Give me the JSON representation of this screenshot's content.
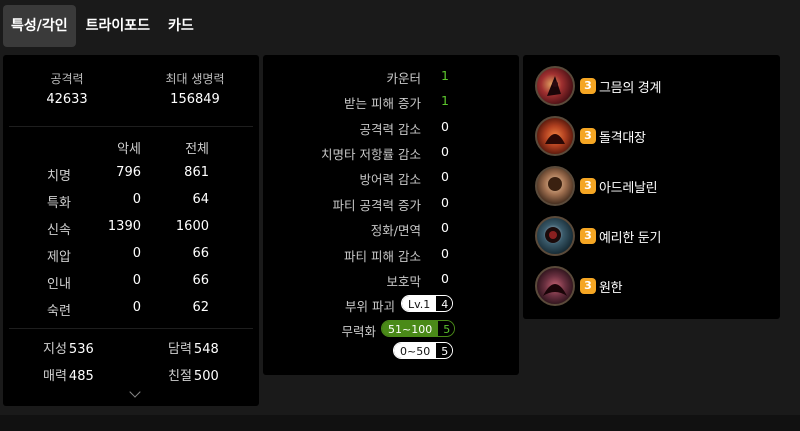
{
  "tabs": [
    {
      "label": "특성/각인",
      "active": true
    },
    {
      "label": "트라이포드",
      "active": false
    },
    {
      "label": "카드",
      "active": false
    }
  ],
  "stats": {
    "attack_label": "공격력",
    "attack_value": "42633",
    "hp_label": "최대 생명력",
    "hp_value": "156849",
    "col_headers": [
      "악세",
      "전체"
    ],
    "rows": [
      {
        "name": "치명",
        "acc": "796",
        "total": "861"
      },
      {
        "name": "특화",
        "acc": "0",
        "total": "64"
      },
      {
        "name": "신속",
        "acc": "1390",
        "total": "1600"
      },
      {
        "name": "제압",
        "acc": "0",
        "total": "66"
      },
      {
        "name": "인내",
        "acc": "0",
        "total": "66"
      },
      {
        "name": "숙련",
        "acc": "0",
        "total": "62"
      }
    ],
    "extras": [
      {
        "name": "지성",
        "value": "536"
      },
      {
        "name": "담력",
        "value": "548"
      },
      {
        "name": "매력",
        "value": "485"
      },
      {
        "name": "친절",
        "value": "500"
      }
    ]
  },
  "modifiers": {
    "rows": [
      {
        "label": "카운터",
        "value": "1",
        "green": true
      },
      {
        "label": "받는 피해 증가",
        "value": "1",
        "green": true
      },
      {
        "label": "공격력 감소",
        "value": "0",
        "green": false
      },
      {
        "label": "치명타 저항률 감소",
        "value": "0",
        "green": false
      },
      {
        "label": "방어력 감소",
        "value": "0",
        "green": false
      },
      {
        "label": "파티 공격력 증가",
        "value": "0",
        "green": false
      },
      {
        "label": "정화/면역",
        "value": "0",
        "green": false
      },
      {
        "label": "파티 피해 감소",
        "value": "0",
        "green": false
      },
      {
        "label": "보호막",
        "value": "0",
        "green": false
      }
    ],
    "part_break": {
      "label": "부위 파괴",
      "level": "Lv.1",
      "count": "4"
    },
    "stagger": {
      "label": "무력화",
      "range1": "51~100",
      "count1": "5",
      "range2": "0~50",
      "count2": "5"
    }
  },
  "engravings": [
    {
      "level": "3",
      "name": "그믐의 경계",
      "icon": "witch-icon",
      "color": "#a03030"
    },
    {
      "level": "3",
      "name": "돌격대장",
      "icon": "charge-icon",
      "color": "#b04020"
    },
    {
      "level": "3",
      "name": "아드레날린",
      "icon": "adrenaline-icon",
      "color": "#a07050"
    },
    {
      "level": "3",
      "name": "예리한 둔기",
      "icon": "blunt-icon",
      "color": "#3a5a6a"
    },
    {
      "level": "3",
      "name": "원한",
      "icon": "grudge-icon",
      "color": "#6a3040"
    }
  ]
}
